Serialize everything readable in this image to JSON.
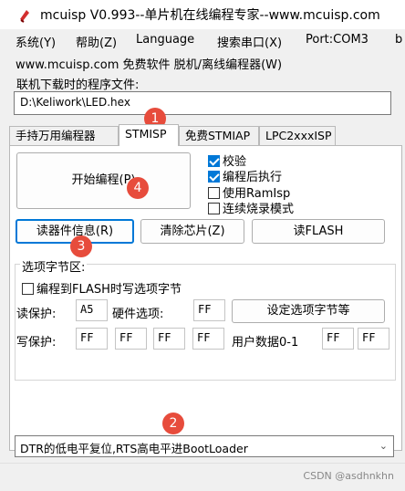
{
  "window": {
    "title": "mcuisp V0.993--单片机在线编程专家--www.mcuisp.com"
  },
  "menu": {
    "items": [
      "系统(Y)",
      "帮助(Z)",
      "Language",
      "搜索串口(X)",
      "Port:COM3",
      "b"
    ]
  },
  "submenu": {
    "text": "www.mcuisp.com 免费软件 脱机/离线编程器(W)"
  },
  "file": {
    "label": "联机下载时的程序文件:",
    "path": "D:\\Keliwork\\LED.hex"
  },
  "tabs": [
    "手持万用编程器",
    "STMISP",
    "免费STMIAP",
    "LPC2xxxISP"
  ],
  "actions": {
    "start_label": "开始编程(P)",
    "read_info_label": "读器件信息(R)",
    "erase_label": "清除芯片(Z)",
    "read_flash_label": "读FLASH",
    "set_option_label": "设定选项字节等"
  },
  "options": {
    "verify": "校验",
    "run_after": "编程后执行",
    "use_ramisp": "使用RamIsp",
    "continuous": "连续烧录模式"
  },
  "option_bytes": {
    "group_label": "选项字节区:",
    "write_to_flash": "编程到FLASH时写选项字节",
    "read_protect_label": "读保护:",
    "read_protect_value": "A5",
    "hw_option_label": "硬件选项:",
    "hw_option_value": "FF",
    "write_protect_label": "写保护:",
    "write_protect_values": [
      "FF",
      "FF",
      "FF",
      "FF"
    ],
    "user_data_label": "用户数据0-1",
    "user_data_values": [
      "FF",
      "FF"
    ]
  },
  "bootmode": {
    "selected": "DTR的低电平复位,RTS高电平进BootLoader"
  },
  "annotations": [
    "1",
    "2",
    "3",
    "4"
  ],
  "watermark": "CSDN @asdhnkhn",
  "colors": {
    "accent": "#0078d7",
    "marker": "#e74c3c"
  }
}
